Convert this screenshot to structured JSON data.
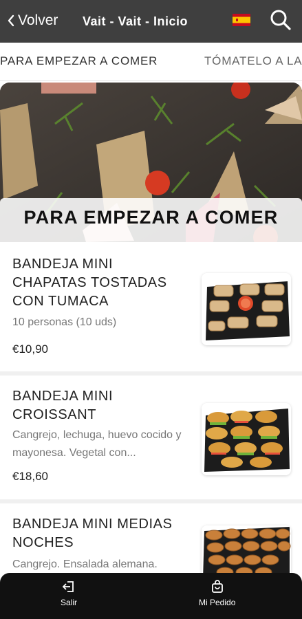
{
  "header": {
    "back_label": "Volver",
    "title": "Vait - Vait - Inicio",
    "language_flag": "spain-flag-icon",
    "search_icon": "search-icon"
  },
  "tabs": [
    {
      "label": "PARA EMPEZAR A COMER",
      "active": true
    },
    {
      "label": "TÓMATELO A LA",
      "active": false
    }
  ],
  "hero": {
    "title": "PARA EMPEZAR A COMER"
  },
  "products": [
    {
      "name": "BANDEJA MINI CHAPATAS TOSTADAS CON TUMACA",
      "description": "10 personas (10 uds)",
      "price": "€10,90"
    },
    {
      "name": "BANDEJA MINI CROISSANT",
      "description": "Cangrejo, lechuga, huevo cocido y mayonesa. Vegetal con...",
      "price": "€18,60"
    },
    {
      "name": "BANDEJA MINI MEDIAS NOCHES",
      "description": "Cangrejo. Ensalada alemana.",
      "price": ""
    }
  ],
  "bottom_nav": {
    "exit_label": "Salir",
    "order_label": "Mi Pedido"
  },
  "colors": {
    "topbar": "#3f3f3f",
    "bottombar": "#111111"
  }
}
